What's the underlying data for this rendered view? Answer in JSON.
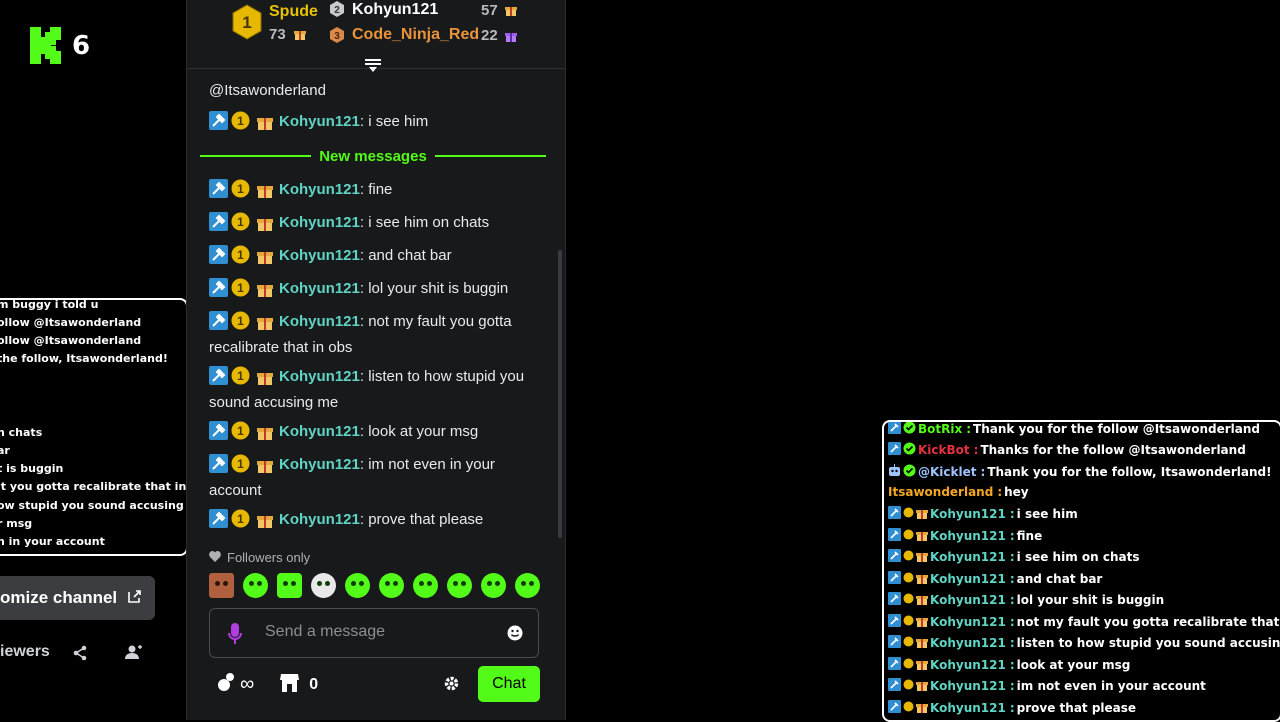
{
  "channel": {
    "logo_icon": "kick-logo-icon",
    "number": "6"
  },
  "left_overlay": {
    "lines": [
      "m buggy i told u",
      "ollow @Itsawonderland",
      "ollow @Itsawonderland",
      "the follow, Itsawonderland!",
      "n chats",
      "ar",
      "t is buggin",
      "it you gotta recalibrate that in obs",
      "ow stupid you sound accusing me",
      "r msg",
      "n in your account"
    ]
  },
  "customize": {
    "label": "omize channel"
  },
  "viewers": {
    "label": "iewers"
  },
  "leaderboard": {
    "first": {
      "rank": "1",
      "name": "Spude",
      "score": "73"
    },
    "second": {
      "rank": "2",
      "name": "Kohyun121",
      "score": "57"
    },
    "third": {
      "rank": "3",
      "name": "Code_Ninja_Red",
      "score": "22"
    }
  },
  "chat": {
    "mention": "@Itsawonderland",
    "new_messages_label": "New messages",
    "messages": [
      {
        "user": "Kohyun121",
        "text": ": i see him"
      },
      {
        "user": "Kohyun121",
        "text": ": fine"
      },
      {
        "user": "Kohyun121",
        "text": ": i see him on chats"
      },
      {
        "user": "Kohyun121",
        "text": ": and chat bar"
      },
      {
        "user": "Kohyun121",
        "text": ": lol your shit is buggin"
      },
      {
        "user": "Kohyun121",
        "text": ": not my fault you gotta recalibrate that in obs"
      },
      {
        "user": "Kohyun121",
        "text": ": listen to how stupid you sound accusing me"
      },
      {
        "user": "Kohyun121",
        "text": ": look at your msg"
      },
      {
        "user": "Kohyun121",
        "text": ": im not even in your account"
      },
      {
        "user": "Kohyun121",
        "text": ": prove that please"
      }
    ],
    "badge_number": "1",
    "followers_only_label": "Followers only",
    "input_placeholder": "Send a message",
    "points_infinity": "∞",
    "store_count": "0",
    "chat_button_label": "Chat"
  },
  "right_overlay": {
    "lines": [
      {
        "user": "BotRix",
        "user_color": "#53fc18",
        "text": " Thank you for the follow @Itsawonderland"
      },
      {
        "user": "KickBot",
        "user_color": "#e5313f",
        "text": " Thanks for the follow @Itsawonderland"
      },
      {
        "user": "@Kicklet",
        "user_color": "#9ec3ff",
        "text": " Thank you for the follow, Itsawonderland!"
      },
      {
        "user": "Itsawonderland",
        "user_color": "#f5a623",
        "text": " hey"
      },
      {
        "user": "Kohyun121",
        "user_color": "#5fd4c4",
        "text": " i see him"
      },
      {
        "user": "Kohyun121",
        "user_color": "#5fd4c4",
        "text": " fine"
      },
      {
        "user": "Kohyun121",
        "user_color": "#5fd4c4",
        "text": " i see him on chats"
      },
      {
        "user": "Kohyun121",
        "user_color": "#5fd4c4",
        "text": " and chat bar"
      },
      {
        "user": "Kohyun121",
        "user_color": "#5fd4c4",
        "text": " lol your shit is buggin"
      },
      {
        "user": "Kohyun121",
        "user_color": "#5fd4c4",
        "text": " not my fault you gotta recalibrate that in obs"
      },
      {
        "user": "Kohyun121",
        "user_color": "#5fd4c4",
        "text": " listen to how stupid you sound accusing me"
      },
      {
        "user": "Kohyun121",
        "user_color": "#5fd4c4",
        "text": " look at your msg"
      },
      {
        "user": "Kohyun121",
        "user_color": "#5fd4c4",
        "text": " im not even in your account"
      },
      {
        "user": "Kohyun121",
        "user_color": "#5fd4c4",
        "text": " prove that please"
      }
    ]
  },
  "colors": {
    "accent": "#53fc18",
    "username": "#5fd4c4",
    "gold": "#e6c200",
    "panel": "#18191b"
  }
}
